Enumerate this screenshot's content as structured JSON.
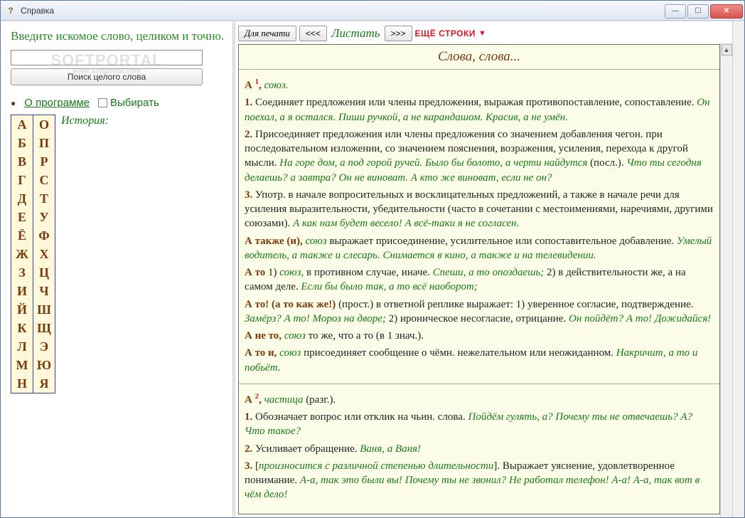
{
  "window": {
    "title": "Справка"
  },
  "left": {
    "prompt": "Введите искомое слово, целиком и точно.",
    "search_button": "Поиск целого слова",
    "watermark_line1": "SOFTPORTAL",
    "watermark_line2": "www.softportal.com",
    "about_link": "О программе",
    "choose_label": "Выбирать",
    "history_label": "История:",
    "alphabet_col1": [
      "А",
      "Б",
      "В",
      "Г",
      "Д",
      "Е",
      "Ё",
      "Ж",
      "З",
      "И",
      "Й",
      "К",
      "Л",
      "М",
      "Н"
    ],
    "alphabet_col2": [
      "О",
      "П",
      "Р",
      "С",
      "Т",
      "У",
      "Ф",
      "Х",
      "Ц",
      "Ч",
      "Ш",
      "Щ",
      "Э",
      "Ю",
      "Я"
    ]
  },
  "topbar": {
    "print": "Для печати",
    "prev": "<<<",
    "pages": "Листать",
    "next": ">>>",
    "more": "ЕЩЁ СТРОКИ"
  },
  "article": {
    "heading": "Слова, слова...",
    "entry1": {
      "hw_open": "А ",
      "sup": "1",
      "hw_close": ", ",
      "pos": "союз.",
      "s1_num": "1.",
      "s1_txt": " Соединяет предложения или члены предложения, выражая противопоставление, сопоставление. ",
      "s1_ex": "Он поехал, а я остался. Пиши ручкой, а не карандашом. Красив, а не умён.",
      "s2_num": "2.",
      "s2_txt": " Присоединяет предложения или члены предложения со значением добавления чегон. при последовательном изложении, со значением пояснения, возражения, усиления, перехода к другой мысли. ",
      "s2_ex1": "На горе дом, а под горой ручей. Было бы болото, а черти найдутся",
      "s2_paren": " (посл.). ",
      "s2_ex2": "Что ты сегодня делаешь? а завтра? Он не виноват. А кто же виноват, если не он?",
      "s3_num": "3.",
      "s3_txt": " Употр. в начале вопросительных и восклицательных предложений, а также в начале речи для усиления выразительности, убедительности (часто в сочетании с местоимениями, наречиями, другими союзами). ",
      "s3_ex": "А как нам будет весело! А всё-таки я не согласен.",
      "p4_hw": "А также (и), ",
      "p4_pos": "союз",
      "p4_txt": " выражает присоединение, усилительное или сопоставительное добавление. ",
      "p4_ex": "Умелый водитель, а также и слесарь. Снимается в кино, а также и на телевидении.",
      "p5_hw": "А то",
      "p5_txt1": " 1) ",
      "p5_pos": "союз,",
      "p5_txt2": " в противном случае, иначе. ",
      "p5_ex1": "Спеши, а то опоздаешь;",
      "p5_txt3": " 2) в действительности же, а на самом деле. ",
      "p5_ex2": "Если бы было так, а то всё наоборот;",
      "p6_hw": "А то! (а то как же!)",
      "p6_txt1": " (прост.) в ответной реплике выражает: 1) уверенное согласие, подтверждение. ",
      "p6_ex1": "Замёрз? А то! Мороз на дворе;",
      "p6_txt2": " 2) ироническое несогласие, отрицание. ",
      "p6_ex2": "Он пойдёт? А то! Дожидайся!",
      "p7_hw": "А не то, ",
      "p7_pos": "союз",
      "p7_txt": " то же, что а то (в 1 знач.).",
      "p8_hw": "А то и, ",
      "p8_pos": "союз",
      "p8_txt": " присоединяет сообщение о чёмн. нежелательном или неожиданном. ",
      "p8_ex": "Накричит, а то и побьёт."
    },
    "entry2": {
      "hw_open": "А ",
      "sup": "2",
      "hw_close": ", ",
      "pos": "частица",
      "paren": " (разг.).",
      "s1_num": "1.",
      "s1_txt": " Обозначает вопрос или отклик на чьин. слова. ",
      "s1_ex": "Пойдём гулять, а? Почему ты не отвечаешь? А? Что такое?",
      "s2_num": "2.",
      "s2_txt": " Усиливает обращение. ",
      "s2_ex": "Ваня, а Ваня!",
      "s3_num": "3.",
      "s3_open": " [",
      "s3_pron": "произносится с различной степенью длительности",
      "s3_close": "]. Выражает уяснение, удовлетворенное понимание. ",
      "s3_ex": "А-а, так это были вы! Почему ты не звонил? Не работал телефон! А-а! А-а, так вот в чём дело!"
    }
  }
}
